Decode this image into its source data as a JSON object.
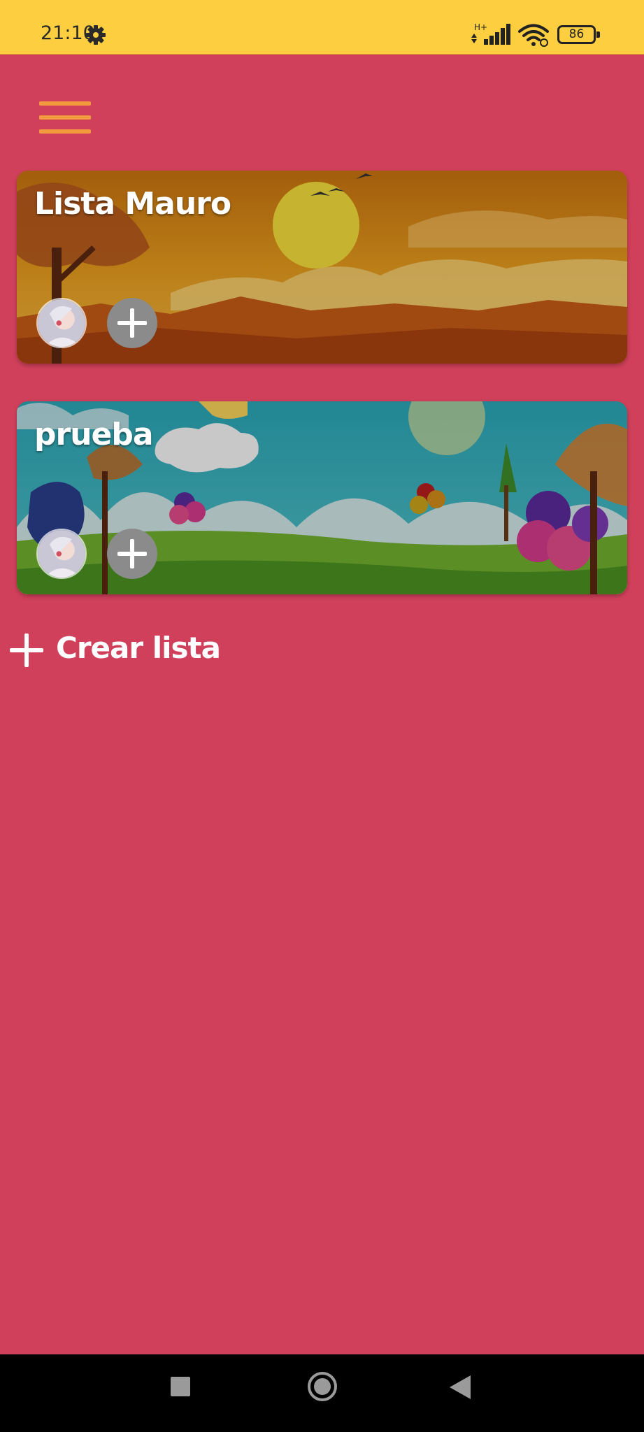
{
  "status_bar": {
    "time": "21:10",
    "network_type": "H+",
    "battery_level": "86",
    "icons": [
      "gear-icon",
      "signal-icon",
      "wifi-icon",
      "battery-icon"
    ],
    "background_color": "#fdce3f"
  },
  "app": {
    "background_color": "#d0405a",
    "menu_color": "#f39a3c"
  },
  "lists": [
    {
      "title": "Lista Mauro",
      "theme": "sunset-landscape"
    },
    {
      "title": "prueba",
      "theme": "balloons-park"
    }
  ],
  "create_list": {
    "label": "Crear lista"
  },
  "nav_bar": {
    "buttons": [
      "recent-apps",
      "home",
      "back"
    ]
  }
}
